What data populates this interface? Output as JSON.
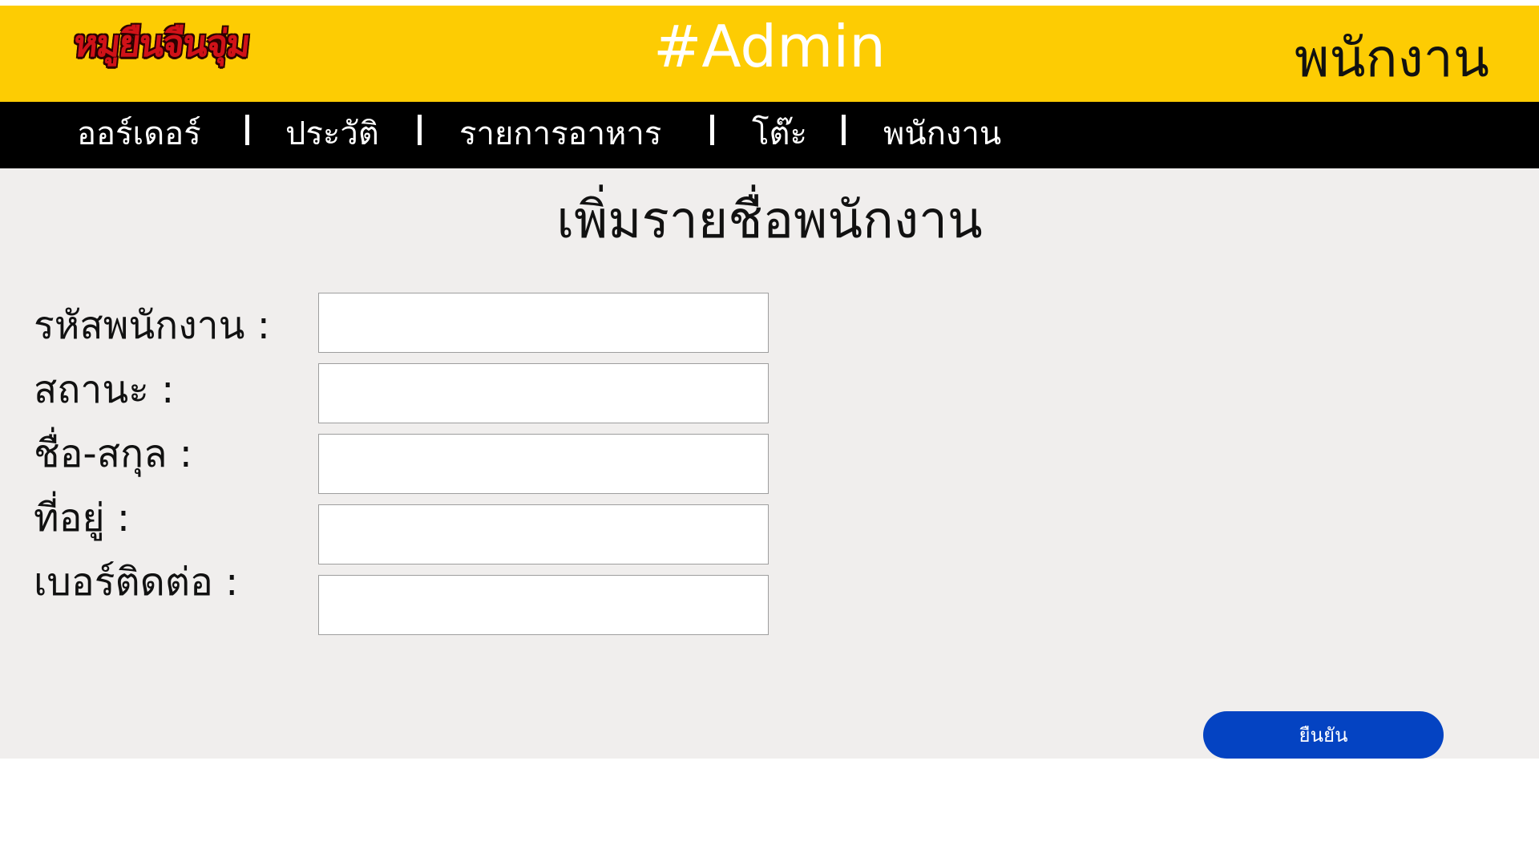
{
  "header": {
    "logo_text": "หมูยืนจืนจุ่ม",
    "title": "#Admin",
    "section": "พนักงาน",
    "colors": {
      "background": "#fdcc03",
      "title": "#ffffff",
      "section": "#111111",
      "logo": "#d01218"
    }
  },
  "nav": {
    "items": [
      {
        "label": "ออร์เดอร์"
      },
      {
        "label": "ประวัติ"
      },
      {
        "label": "รายการอาหาร"
      },
      {
        "label": "โต๊ะ"
      },
      {
        "label": "พนักงาน"
      }
    ],
    "separator": "|",
    "colors": {
      "background": "#000000",
      "text": "#ffffff"
    }
  },
  "form": {
    "title": "เพิ่มรายชื่อพนักงาน",
    "fields": [
      {
        "label": "รหัสพนักงาน :",
        "value": ""
      },
      {
        "label": "สถานะ :",
        "value": ""
      },
      {
        "label": "ชื่อ-สกุล :",
        "value": ""
      },
      {
        "label": "ที่อยู่ :",
        "value": ""
      },
      {
        "label": "เบอร์ติดต่อ :",
        "value": ""
      }
    ],
    "submit_label": "ยืนยัน",
    "colors": {
      "background": "#f0eeed",
      "button": "#0443c2"
    }
  }
}
